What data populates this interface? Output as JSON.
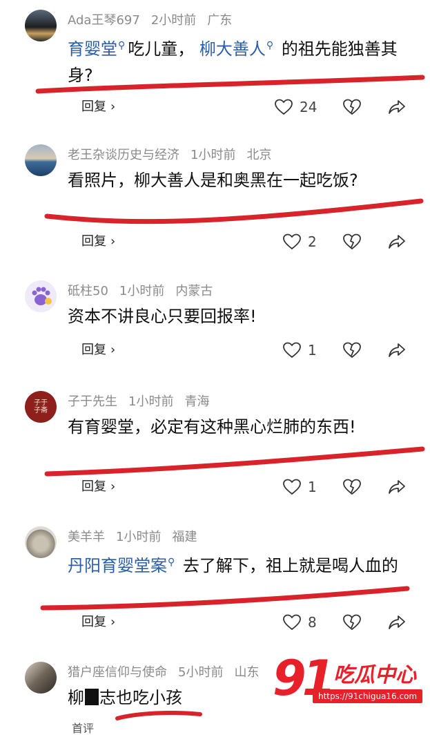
{
  "comments": [
    {
      "username": "Ada王琴697",
      "time": "2小时前",
      "location": "广东",
      "text_parts": [
        "育婴堂",
        "吃儿童，",
        "柳大善人",
        "的祖先能独善其身?"
      ],
      "reply_label": "回复",
      "likes": "24"
    },
    {
      "username": "老王杂谈历史与经济",
      "time": "1小时前",
      "location": "北京",
      "text": "看照片，柳大善人是和奥黑在一起吃饭?",
      "reply_label": "回复",
      "likes": "2"
    },
    {
      "username": "砥柱50",
      "time": "1小时前",
      "location": "内蒙古",
      "text": "资本不讲良心只要回报率!",
      "reply_label": "回复",
      "likes": "1"
    },
    {
      "username": "子于先生",
      "time": "1小时前",
      "location": "青海",
      "text": "有育婴堂，必定有这种黑心烂肺的东西!",
      "reply_label": "回复",
      "likes": "1",
      "avatar_text": "子于子斋"
    },
    {
      "username": "美羊羊",
      "time": "1小时前",
      "location": "福建",
      "text_parts": [
        "丹阳育婴堂案",
        "去了解下，祖上就是喝人血的"
      ],
      "reply_label": "回复",
      "likes": "8"
    },
    {
      "username": "猎户座信仰与使命",
      "time": "5小时前",
      "location": "山东",
      "text_before": "柳",
      "text_after": "志也吃小孩",
      "tag": "首评"
    }
  ],
  "watermark": {
    "number": "91",
    "label": "吃瓜中心",
    "url": "https://91chigua16.com"
  },
  "colors": {
    "link": "#2a5ea8",
    "annotation_red": "#d8232a",
    "meta_gray": "#8a8a8a"
  },
  "icons": [
    "heart-icon",
    "broken-heart-icon",
    "share-icon",
    "search-icon",
    "chevron-right-icon"
  ]
}
